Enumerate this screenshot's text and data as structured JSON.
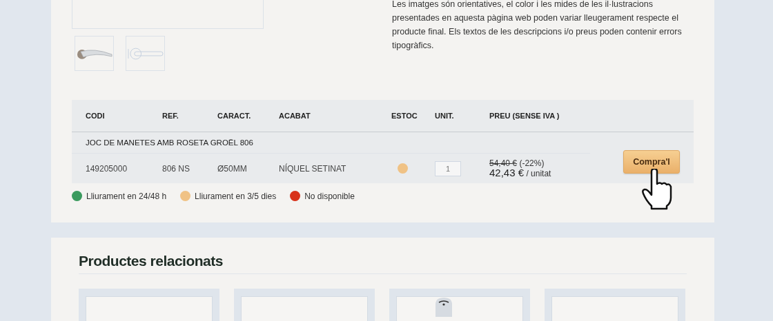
{
  "gallery": {
    "thumbnails": [
      {
        "kind": "lever-handle"
      },
      {
        "kind": "handle-sketch"
      }
    ]
  },
  "disclaimer": "Les imatges són orientatives, el color i les mides de les il·lustracions presentades en aquesta pàgina web poden variar lleugerament respecte el producte final. Els textos de les descripcions i/o preus poden contenir errors tipogràfics.",
  "table": {
    "columns": [
      "CODI",
      "REF.",
      "CARACT.",
      "ACABAT",
      "ESTOC",
      "UNIT.",
      "PREU (SENSE IVA )"
    ],
    "product_name": "JOC DE MANETES AMB ROSETA GROËL 806",
    "rows": [
      {
        "code": "149205000",
        "ref": "806 NS",
        "feature": "Ø50MM",
        "finish": "NÍQUEL SETINAT",
        "color": "#f0c285",
        "quantity": "1",
        "old_price": "54,40 €",
        "discount": "(-22%)",
        "price": "42,43 €",
        "unit": "/ unitat",
        "button": "Compra'l"
      }
    ]
  },
  "legend": [
    {
      "label": "Lliurament en 24/48 h",
      "color": "#3a9a5e"
    },
    {
      "label": "Lliurament en 3/5 dies",
      "color": "#f0c285"
    },
    {
      "label": "No disponible",
      "color": "#d8321a"
    }
  ],
  "related": {
    "title": "Productes relacionats",
    "cards": [
      {
        "kind": "empty"
      },
      {
        "kind": "empty"
      },
      {
        "kind": "picture"
      },
      {
        "kind": "empty"
      }
    ]
  }
}
